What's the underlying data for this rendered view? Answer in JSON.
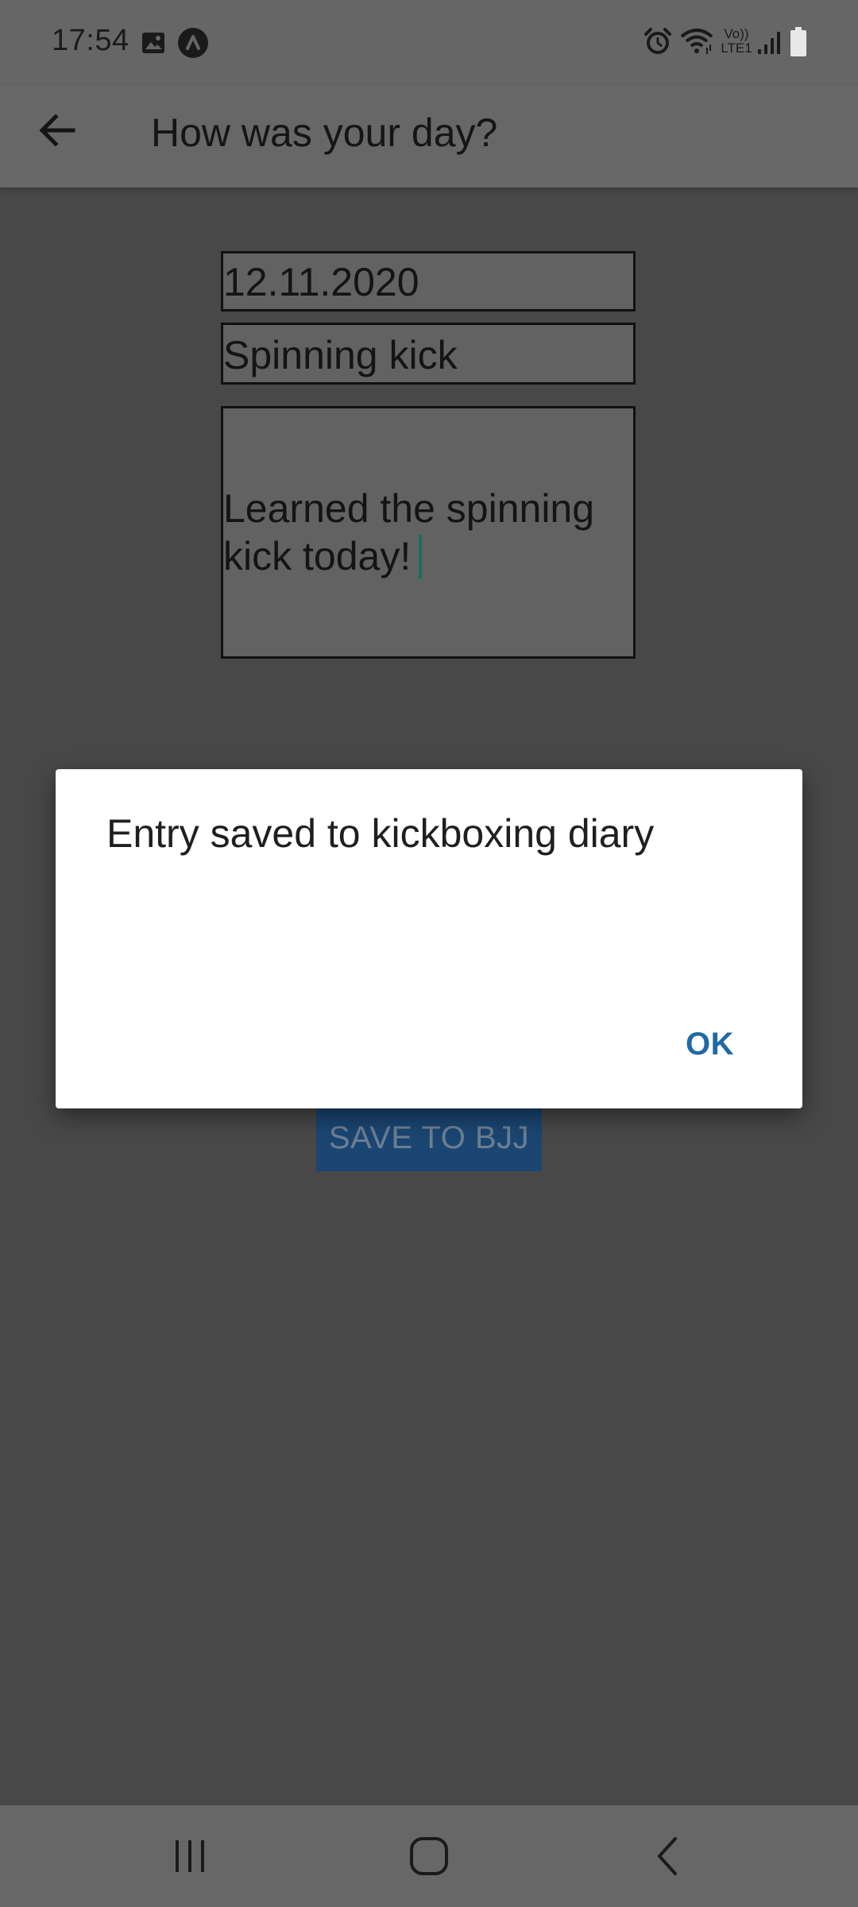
{
  "status_bar": {
    "time": "17:54",
    "icons": [
      "image-icon",
      "app-notification-icon",
      "alarm-icon",
      "wifi-icon",
      "volte-icon",
      "signal-icon",
      "battery-icon"
    ],
    "volte_label": "Vo))",
    "lte_label": "LTE1"
  },
  "app_bar": {
    "title": "How was your day?",
    "back_icon": "arrow-back-icon"
  },
  "form": {
    "date_value": "12.11.2020",
    "title_value": "Spinning kick",
    "notes_value": "Learned the spinning kick today!"
  },
  "background_button": {
    "label": "SAVE TO BJJ"
  },
  "dialog": {
    "message": "Entry saved to kickboxing diary",
    "ok_label": "OK"
  },
  "nav_bar": {
    "icons": [
      "recent-apps-icon",
      "home-icon",
      "back-icon"
    ]
  },
  "colors": {
    "scrim": "#484848",
    "bar": "#676767",
    "dialog_background": "#ffffff",
    "accent": "#1f6aa5",
    "button_dimmed": "#1b4672"
  }
}
